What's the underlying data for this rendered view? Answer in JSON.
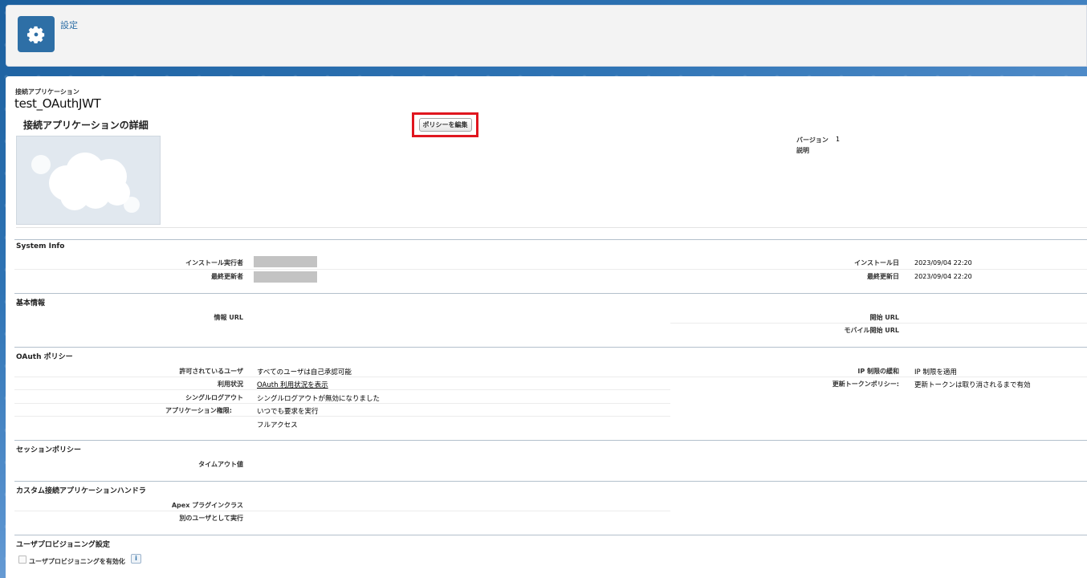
{
  "header": {
    "title": "設定",
    "icon": "gear-icon"
  },
  "entity": {
    "type_label": "接続アプリケーション",
    "name": "test_OAuthJWT",
    "detail_title": "接続アプリケーションの詳細",
    "edit_policy_button": "ポリシーを編集",
    "version_label": "バージョン",
    "version_value": "1",
    "description_label": "説明"
  },
  "system_info": {
    "title": "System Info",
    "installed_by_label": "インストール実行者",
    "last_modified_by_label": "最終更新者",
    "installed_date_label": "インストール日",
    "installed_date_value": "2023/09/04 22:20",
    "last_modified_date_label": "最終更新日",
    "last_modified_date_value": "2023/09/04 22:20"
  },
  "basic_info": {
    "title": "基本情報",
    "info_url_label": "情報 URL",
    "start_url_label": "開始 URL",
    "mobile_start_url_label": "モバイル開始 URL"
  },
  "oauth_policy": {
    "title": "OAuth ポリシー",
    "permitted_users_label": "許可されているユーザ",
    "permitted_users_value": "すべてのユーザは自己承認可能",
    "usage_label": "利用状況",
    "usage_link": "OAuth 利用状況を表示",
    "single_logout_label": "シングルログアウト",
    "single_logout_value": "シングルログアウトが無効になりました",
    "app_permissions_label": "アプリケーション権限:",
    "app_permissions_values": [
      "いつでも要求を実行",
      "フルアクセス"
    ],
    "ip_relax_label": "IP 制限の緩和",
    "ip_relax_value": "IP 制限を適用",
    "refresh_token_label": "更新トークンポリシー:",
    "refresh_token_value": "更新トークンは取り消されるまで有効"
  },
  "session_policy": {
    "title": "セッションポリシー",
    "timeout_label": "タイムアウト値"
  },
  "custom_handler": {
    "title": "カスタム接続アプリケーションハンドラ",
    "apex_plugin_label": "Apex プラグインクラス",
    "run_as_label": "別のユーザとして実行"
  },
  "user_provisioning": {
    "title": "ユーザプロビジョニング設定",
    "enable_label": "ユーザプロビジョニングを有効化",
    "info_icon": "i"
  }
}
